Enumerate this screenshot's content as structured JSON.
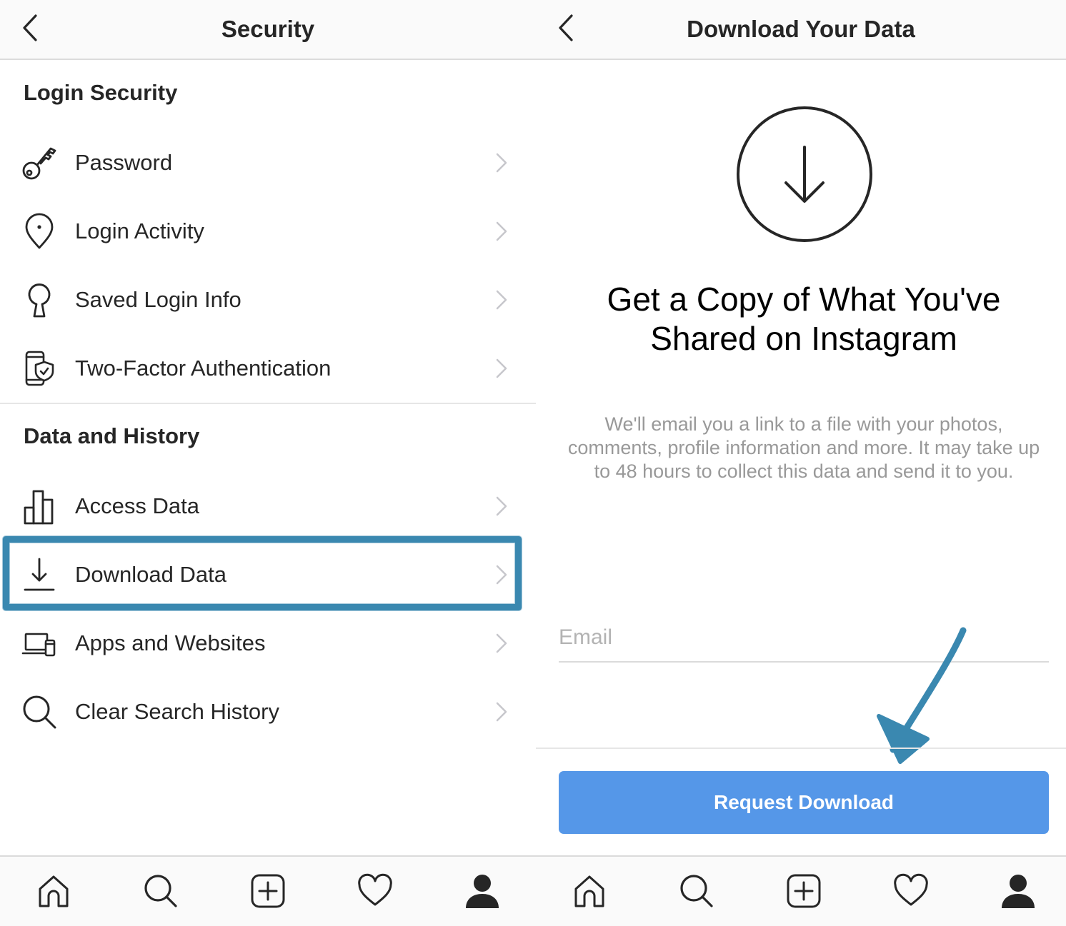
{
  "left_screen": {
    "title": "Security",
    "sections": [
      {
        "header": "Login Security",
        "items": [
          {
            "label": "Password",
            "icon": "key-icon"
          },
          {
            "label": "Login Activity",
            "icon": "location-pin-icon"
          },
          {
            "label": "Saved Login Info",
            "icon": "keyhole-icon"
          },
          {
            "label": "Two-Factor Authentication",
            "icon": "phone-shield-icon"
          }
        ]
      },
      {
        "header": "Data and History",
        "items": [
          {
            "label": "Access Data",
            "icon": "bar-chart-icon"
          },
          {
            "label": "Download Data",
            "icon": "download-icon",
            "highlighted": true
          },
          {
            "label": "Apps and Websites",
            "icon": "laptop-phone-icon"
          },
          {
            "label": "Clear Search History",
            "icon": "search-icon"
          }
        ]
      }
    ]
  },
  "right_screen": {
    "title": "Download Your Data",
    "headline": "Get a Copy of What You've Shared on Instagram",
    "description": "We'll email you a link to a file with your photos, comments, profile information and more. It may take up to 48 hours to collect this data and send it to you.",
    "email_placeholder": "Email",
    "email_value": "",
    "button_label": "Request Download"
  },
  "tab_bar": [
    "home-icon",
    "search-icon",
    "add-post-icon",
    "heart-icon",
    "profile-icon"
  ],
  "colors": {
    "annotation": "#3a88b0",
    "button": "#5597e8",
    "text": "#262626",
    "muted_text": "#999999",
    "divider": "#dbdbdb",
    "bar_background": "#fafafa"
  }
}
